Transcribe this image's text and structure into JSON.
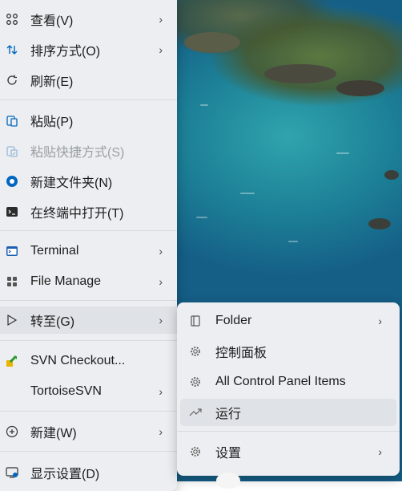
{
  "main_menu": {
    "items": [
      {
        "label": "查看(V)",
        "icon": "grid-view-icon",
        "submenu": true
      },
      {
        "label": "排序方式(O)",
        "icon": "sort-icon",
        "submenu": true
      },
      {
        "label": "刷新(E)",
        "icon": "refresh-icon",
        "submenu": false
      },
      {
        "label": "粘贴(P)",
        "icon": "paste-icon",
        "submenu": false
      },
      {
        "label": "粘贴快捷方式(S)",
        "icon": "paste-shortcut-icon",
        "submenu": false,
        "disabled": true
      },
      {
        "label": "新建文件夹(N)",
        "icon": "new-folder-icon",
        "submenu": false
      },
      {
        "label": "在终端中打开(T)",
        "icon": "terminal-icon",
        "submenu": false
      },
      {
        "label": "Terminal",
        "icon": "windows-terminal-icon",
        "submenu": true
      },
      {
        "label": "File Manage",
        "icon": "file-manage-icon",
        "submenu": true
      },
      {
        "label": "转至(G)",
        "icon": "goto-icon",
        "submenu": true
      },
      {
        "label": "SVN Checkout...",
        "icon": "svn-checkout-icon",
        "submenu": false
      },
      {
        "label": "TortoiseSVN",
        "icon": "",
        "submenu": true
      },
      {
        "label": "新建(W)",
        "icon": "new-icon",
        "submenu": true
      },
      {
        "label": "显示设置(D)",
        "icon": "display-settings-icon",
        "submenu": false
      }
    ]
  },
  "sub_menu": {
    "items": [
      {
        "label": "Folder",
        "icon": "folder-icon",
        "submenu": true
      },
      {
        "label": "控制面板",
        "icon": "gear-icon",
        "submenu": false
      },
      {
        "label": "All Control Panel Items",
        "icon": "gear-icon",
        "submenu": false
      },
      {
        "label": "运行",
        "icon": "run-icon",
        "submenu": false
      },
      {
        "label": "设置",
        "icon": "gear-icon",
        "submenu": true
      }
    ]
  },
  "colors": {
    "menu_bg": "#eceef1",
    "accent_blue": "#0067c0",
    "disabled_text": "#9aa0a6"
  }
}
